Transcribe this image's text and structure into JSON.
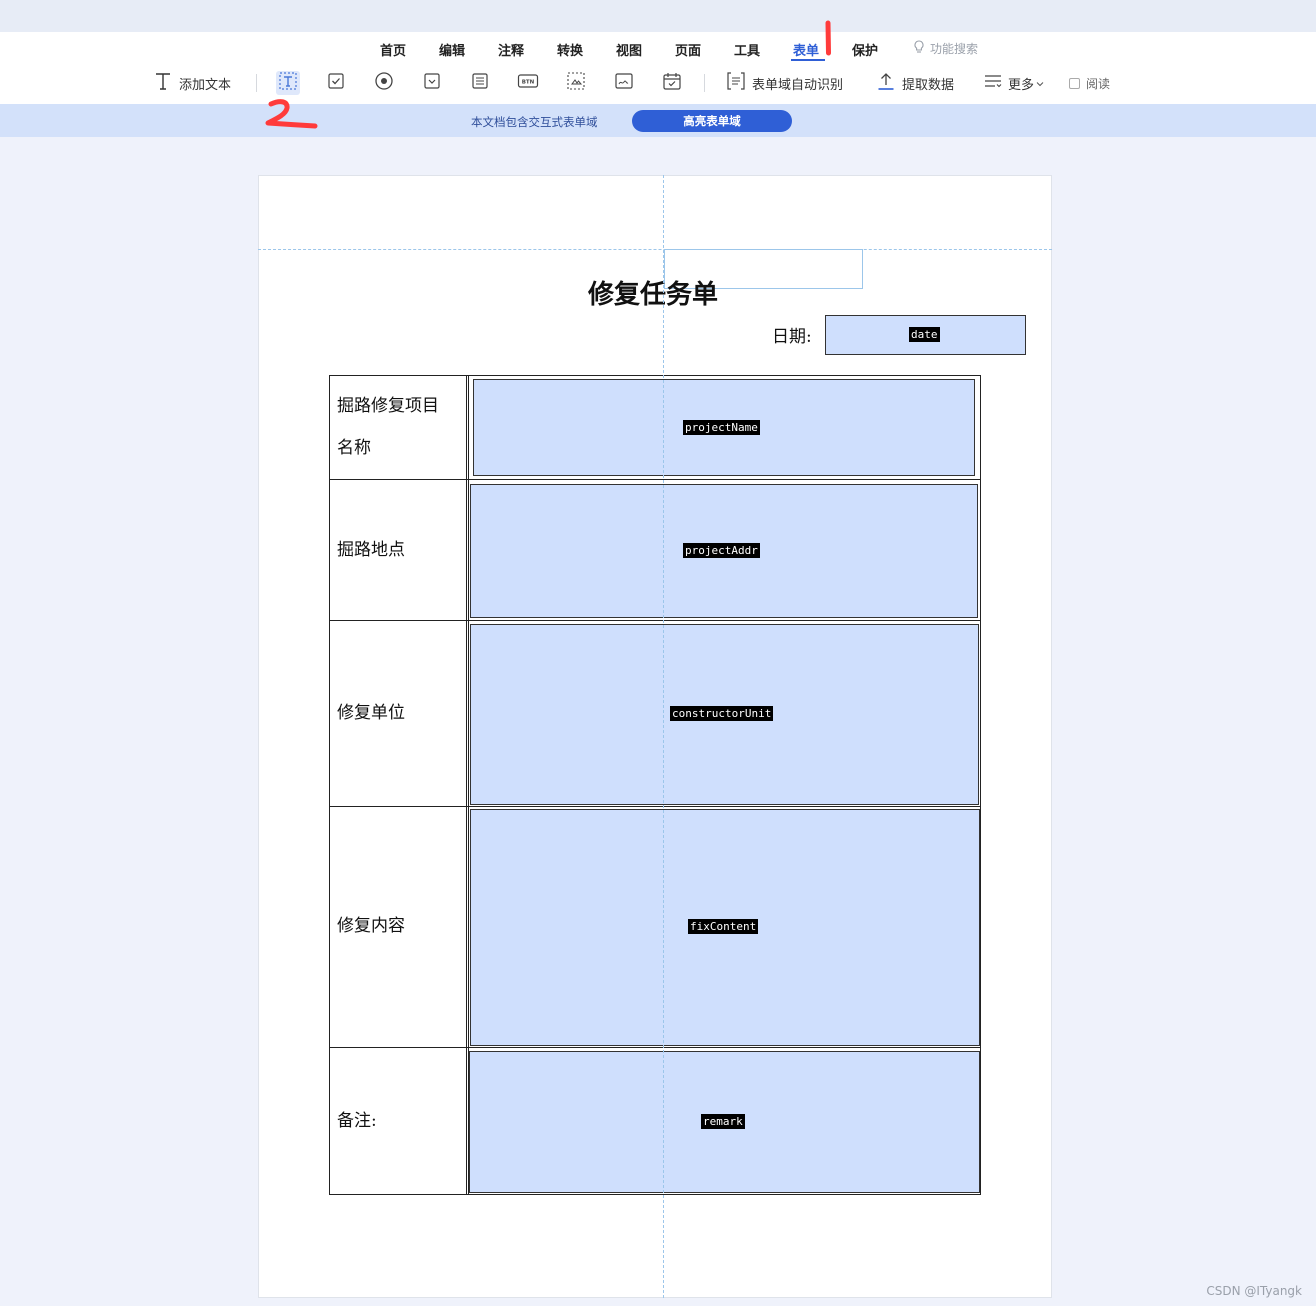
{
  "menu": {
    "items": [
      "首页",
      "编辑",
      "注释",
      "转换",
      "视图",
      "页面",
      "工具",
      "表单",
      "保护"
    ],
    "active": "表单",
    "search_label": "功能搜索"
  },
  "toolbar": {
    "add_text": "添加文本",
    "auto_detect": "表单域自动识别",
    "extract_data": "提取数据",
    "more": "更多",
    "read": "阅读"
  },
  "notice": {
    "message": "本文档包含交互式表单域",
    "highlight_button": "高亮表单域"
  },
  "document": {
    "title": "修复任务单",
    "date_label": "日期:",
    "date_field": "date",
    "rows": [
      {
        "label_line1": "掘路修复项目",
        "label_line2": "名称",
        "field": "projectName"
      },
      {
        "label_line1": "掘路地点",
        "label_line2": "",
        "field": "projectAddr"
      },
      {
        "label_line1": "修复单位",
        "label_line2": "",
        "field": "constructorUnit"
      },
      {
        "label_line1": "修复内容",
        "label_line2": "",
        "field": "fixContent"
      },
      {
        "label_line1": "备注:",
        "label_line2": "",
        "field": "remark"
      }
    ]
  },
  "annotations": {
    "mark1": "1",
    "mark2": "2",
    "color": "#ff3b3b"
  },
  "watermark": "CSDN @ITyangk",
  "colors": {
    "accent": "#2f5fd6",
    "field_fill": "#cfdffd",
    "notice_bg": "#d3e1fa"
  }
}
